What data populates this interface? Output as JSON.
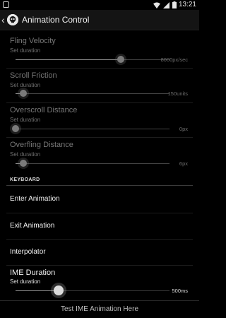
{
  "status_bar": {
    "time": "13:21"
  },
  "action_bar": {
    "title": "Animation Control"
  },
  "settings": [
    {
      "title": "Fling Velocity",
      "summary": "Set duration",
      "value": "8000px/sec",
      "level": 0.68
    },
    {
      "title": "Scroll Friction",
      "summary": "Set duration",
      "value": "150units",
      "level": 0.05
    },
    {
      "title": "Overscroll Distance",
      "summary": "Set duration",
      "value": "0px",
      "level": 0.0
    },
    {
      "title": "Overfling Distance",
      "summary": "Set duration",
      "value": "6px",
      "level": 0.05
    }
  ],
  "keyboard": {
    "header": "KEYBOARD",
    "items": [
      "Enter Animation",
      "Exit Animation",
      "Interpolator"
    ],
    "ime_duration": {
      "title": "IME Duration",
      "summary": "Set duration",
      "value": "500ms",
      "level": 0.28
    },
    "test_button": "Test IME Animation Here"
  },
  "colors": {
    "background": "#000000",
    "action_bar": "#141414",
    "disabled_text": "#777777"
  }
}
